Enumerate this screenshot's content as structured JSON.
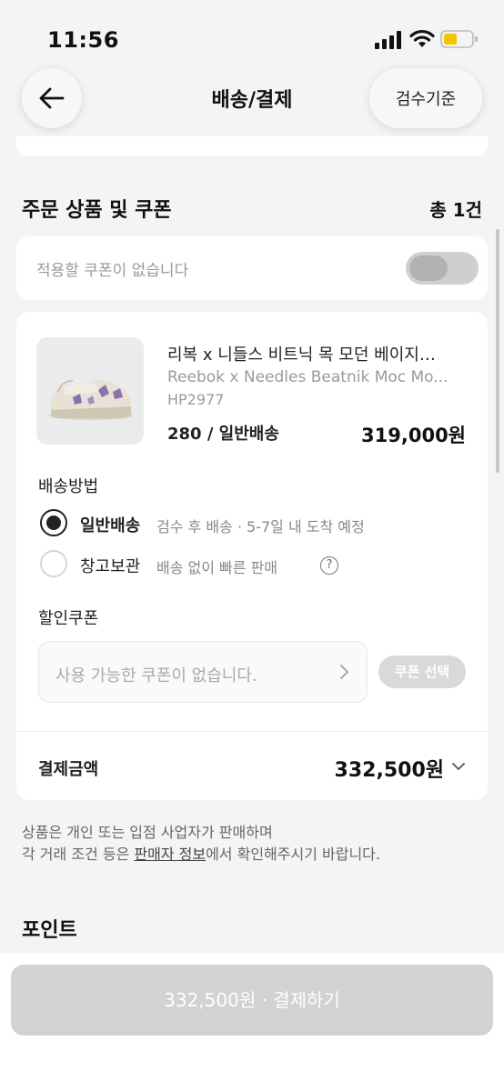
{
  "status_bar": {
    "time": "11:56"
  },
  "header": {
    "title": "배송/결제",
    "criteria_button": "검수기준"
  },
  "order_section": {
    "title": "주문 상품 및 쿠폰",
    "count": "총 1건"
  },
  "coupon_toggle": {
    "text": "적용할 쿠폰이 없습니다",
    "enabled": false
  },
  "product": {
    "name_ko": "리복 x 니들스 비트닉 목 모던 베이지…",
    "name_en": "Reebok x Needles Beatnik Moc Mo...",
    "code": "HP2977",
    "option": "280 / 일반배송",
    "price": "319,000원"
  },
  "shipping": {
    "label": "배송방법",
    "options": [
      {
        "label": "일반배송",
        "desc": "검수 후 배송 · 5-7일 내 도착 예정",
        "selected": true
      },
      {
        "label": "창고보관",
        "desc": "배송 없이 빠른 판매",
        "selected": false
      }
    ]
  },
  "discount": {
    "label": "할인쿠폰",
    "placeholder": "사용 가능한 쿠폰이 없습니다.",
    "select_button": "쿠폰 선택"
  },
  "payment": {
    "label": "결제금액",
    "amount": "332,500원"
  },
  "notice": {
    "line1": "상품은 개인 또는 입점 사업자가 판매하며",
    "line2_pre": "각 거래 조건 등은 ",
    "line2_link": "판매자 정보",
    "line2_post": "에서 확인해주시기 바랍니다."
  },
  "points": {
    "title": "포인트"
  },
  "bottom": {
    "pay_button": "332,500원 · 결제하기"
  },
  "colors": {
    "background": "#f4f4f4",
    "card": "#ffffff",
    "disabled_button": "#d2d2d2",
    "battery": "#f5c400"
  }
}
